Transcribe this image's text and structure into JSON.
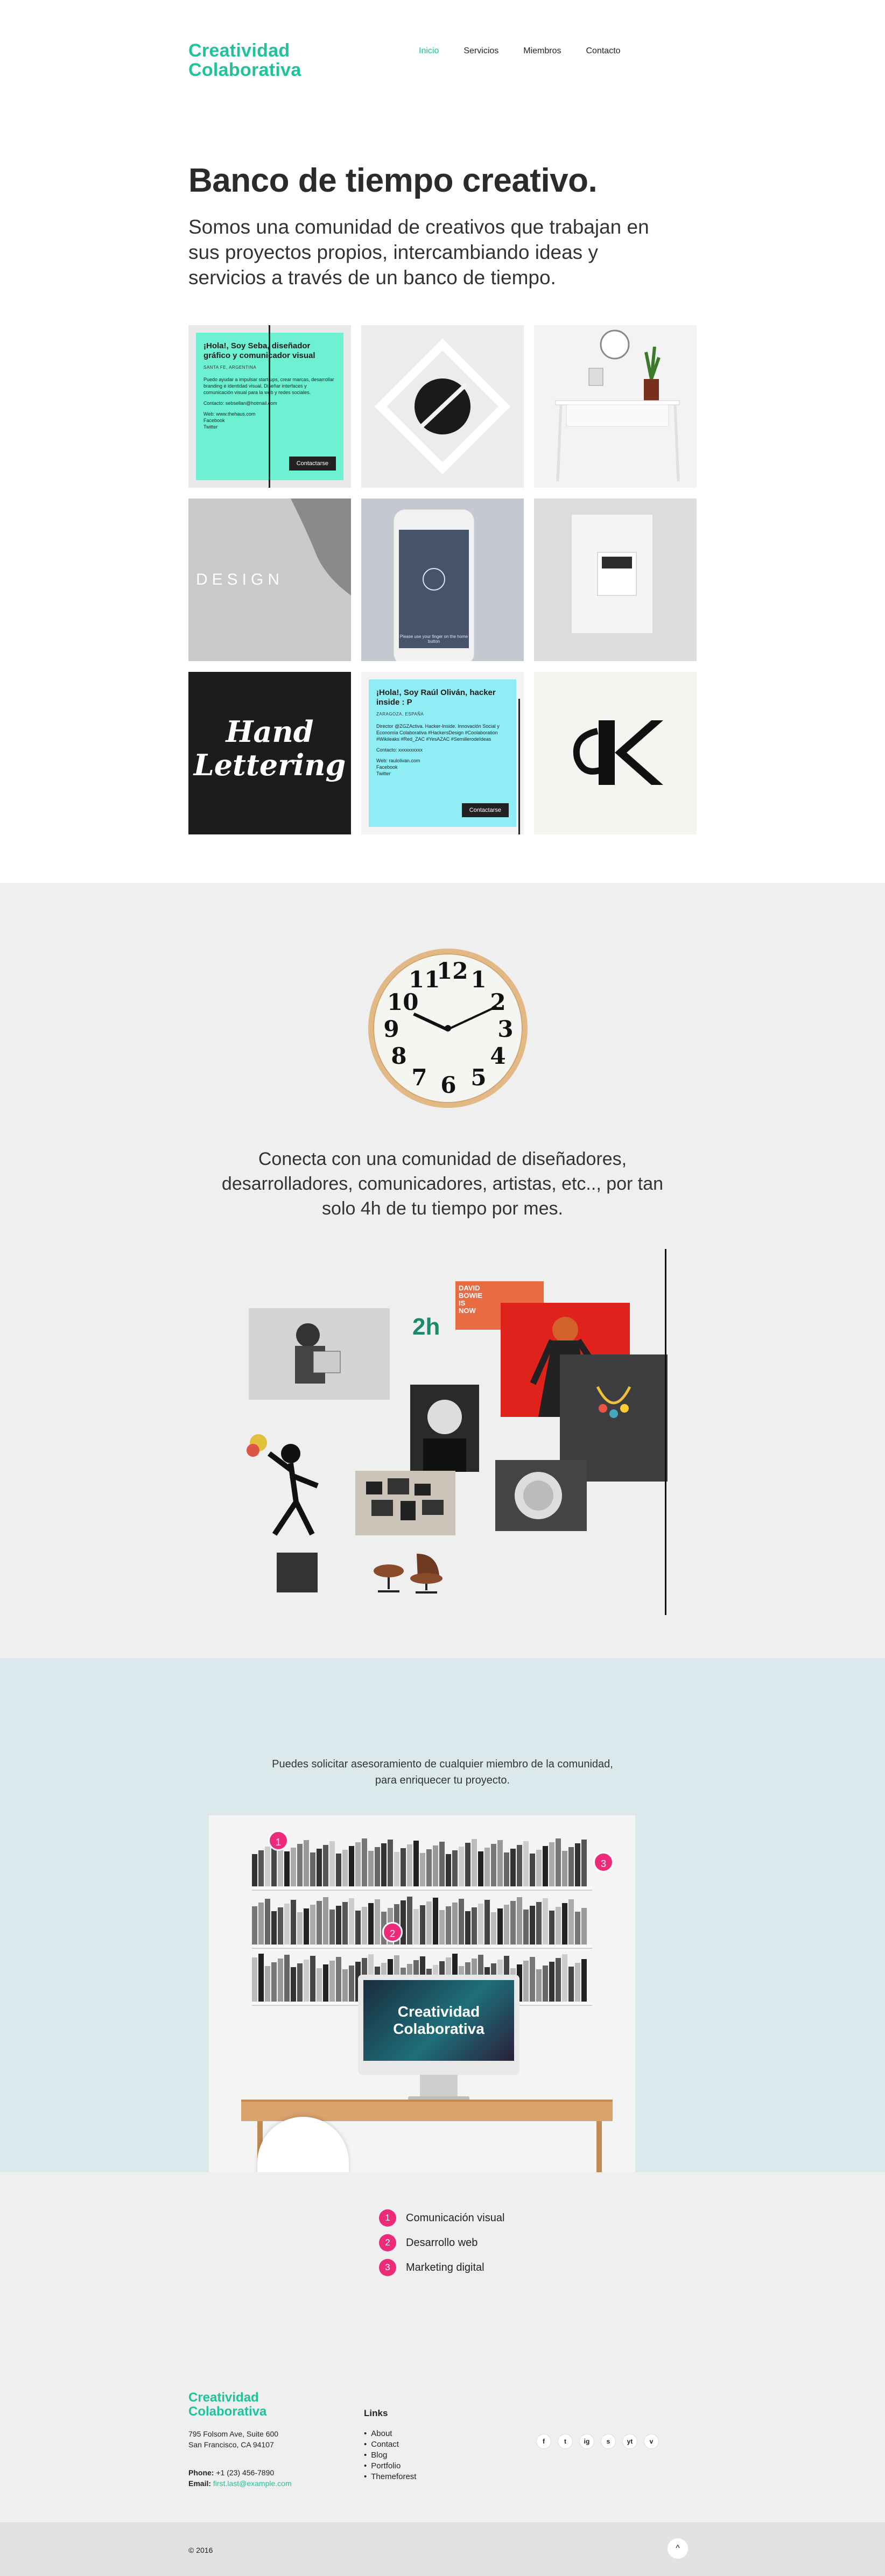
{
  "header": {
    "logo_line1": "Creatividad",
    "logo_line2": "Colaborativa",
    "nav": [
      "Inicio",
      "Servicios",
      "Miembros",
      "Contacto"
    ]
  },
  "hero": {
    "title": "Banco de tiempo creativo.",
    "subtitle": "Somos una comunidad de creativos que trabajan en sus proyectos propios, intercambiando ideas y servicios a través de un banco de tiempo."
  },
  "grid": {
    "card1": {
      "title": "¡Hola!, Soy Seba, diseñador gráfico y comunicador visual",
      "location": "SANTA FE, ARGENTINA",
      "body": "Puedo ayudar a impulsar start-ups, crear marcas, desarrollar branding e identidad visual. Diseñar interfaces y comunicación visual para la web y redes sociales.",
      "contact": "Contacto: sebsellan@hotmail.com",
      "links": [
        "Web: www.thehaus.com",
        "Facebook",
        "Twitter"
      ],
      "button": "Contactarse"
    },
    "design_word": "DESIGN",
    "phone_caption": "Please use your finger on the home button",
    "hand_lettering": [
      "Hand",
      "Lettering"
    ],
    "card2": {
      "title": "¡Hola!, Soy Raúl Oliván, hacker inside : P",
      "location": "ZARAGOZA, ESPAÑA",
      "body": "Director @ZGZActiva. Hacker-Inside. Innovación Social y Economía Colaborativa #HackersDesign #Coolaboration #Wikileaks #Red_ZAC #YesAZAC #SemillerodeIdeas",
      "contact": "Contacto: xxxxxxxxxx",
      "links": [
        "Web: raulolivan.com",
        "Facebook",
        "Twitter"
      ],
      "button": "Contactarse"
    },
    "k_mark": "K"
  },
  "section2": {
    "text": "Conecta con una comunidad de diseñadores, desarrolladores, comunicadores, artistas, etc.., por tan solo 4h de tu tiempo por mes.",
    "collage_label": "2h",
    "poster_text": [
      "DAVID",
      "BOWIE",
      "IS",
      "NOW"
    ]
  },
  "section3": {
    "text": "Puedes solicitar asesoramiento de cualquier miembro de la comunidad, para enriquecer tu proyecto.",
    "monitor_line1": "Creatividad",
    "monitor_line2": "Colaborativa",
    "pins": [
      "1",
      "2",
      "3"
    ]
  },
  "services": [
    {
      "num": "1",
      "label": "Comunicación visual"
    },
    {
      "num": "2",
      "label": "Desarrollo web"
    },
    {
      "num": "3",
      "label": "Marketing digital"
    }
  ],
  "footer": {
    "logo_line1": "Creatividad",
    "logo_line2": "Colaborativa",
    "address1": "795 Folsom Ave, Suite 600",
    "address2": "San Francisco, CA 94107",
    "phone_label": "Phone:",
    "phone": "+1 (23) 456-7890",
    "email_label": "Email:",
    "email": "first.last@example.com",
    "links_title": "Links",
    "links": [
      "About",
      "Contact",
      "Blog",
      "Portfolio",
      "Themeforest"
    ],
    "social": [
      "f",
      "t",
      "ig",
      "s",
      "yt",
      "v"
    ],
    "copyright": "© 2016",
    "totop": "^"
  },
  "colors": {
    "accent": "#1ec39a",
    "pink": "#ee2a7b",
    "section2_bg": "#efefef",
    "section3_bg": "#dbe8ec"
  }
}
